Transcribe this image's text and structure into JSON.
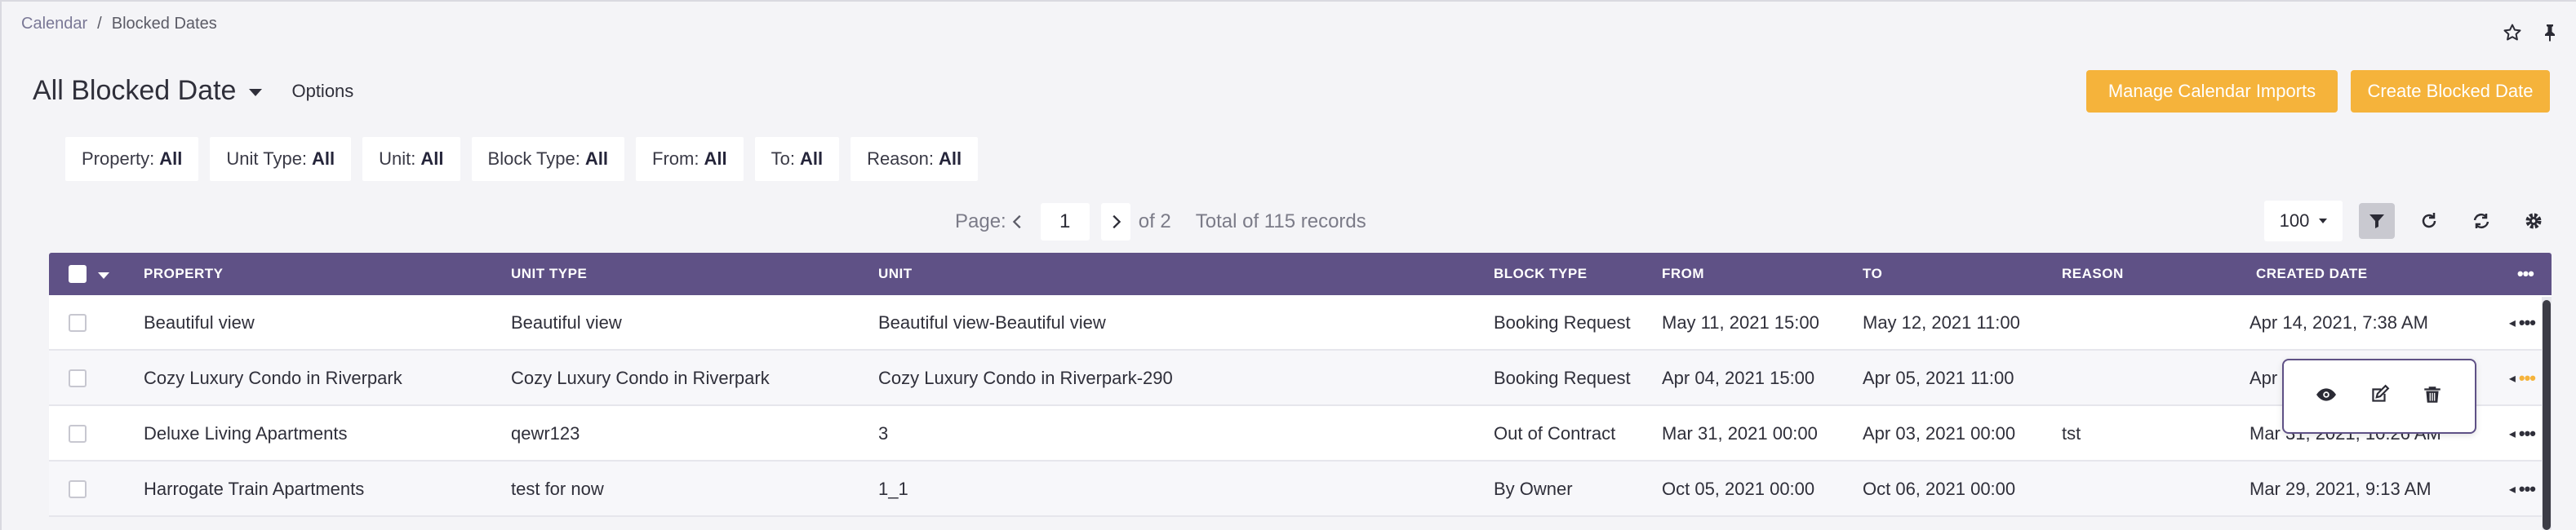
{
  "breadcrumb": {
    "root": "Calendar",
    "separator": "/",
    "current": "Blocked Dates"
  },
  "header": {
    "title": "All Blocked Date",
    "options_label": "Options",
    "manage_imports_label": "Manage Calendar Imports",
    "create_label": "Create Blocked Date"
  },
  "filters": [
    {
      "label": "Property:",
      "value": "All"
    },
    {
      "label": "Unit Type:",
      "value": "All"
    },
    {
      "label": "Unit:",
      "value": "All"
    },
    {
      "label": "Block Type:",
      "value": "All"
    },
    {
      "label": "From:",
      "value": "All"
    },
    {
      "label": "To:",
      "value": "All"
    },
    {
      "label": "Reason:",
      "value": "All"
    }
  ],
  "pager": {
    "page_label": "Page:",
    "current_page": "1",
    "of_pages": "of 2",
    "total": "Total of 115 records",
    "page_size": "100"
  },
  "table": {
    "columns": [
      "PROPERTY",
      "UNIT TYPE",
      "UNIT",
      "BLOCK TYPE",
      "FROM",
      "TO",
      "REASON",
      "CREATED DATE"
    ],
    "rows": [
      [
        "Beautiful view",
        "Beautiful view",
        "Beautiful view-Beautiful view",
        "Booking Request",
        "May 11, 2021 15:00",
        "May 12, 2021 11:00",
        "",
        "Apr 14, 2021, 7:38 AM"
      ],
      [
        "Cozy Luxury Condo in Riverpark",
        "Cozy Luxury Condo in Riverpark",
        "Cozy Luxury Condo in Riverpark-290",
        "Booking Request",
        "Apr 04, 2021 15:00",
        "Apr 05, 2021 11:00",
        "",
        "Apr"
      ],
      [
        "Deluxe Living Apartments",
        "qewr123",
        "3",
        "Out of Contract",
        "Mar 31, 2021 00:00",
        "Apr 03, 2021 00:00",
        "tst",
        "Mar 31, 2021, 10:26 AM"
      ],
      [
        "Harrogate Train Apartments",
        "test for now",
        "1_1",
        "By Owner",
        "Oct 05, 2021 00:00",
        "Oct 06, 2021 00:00",
        "",
        "Mar 29, 2021, 9:13 AM"
      ]
    ]
  },
  "colors": {
    "header_purple": "#5f5186",
    "accent_orange": "#f5b33b"
  }
}
